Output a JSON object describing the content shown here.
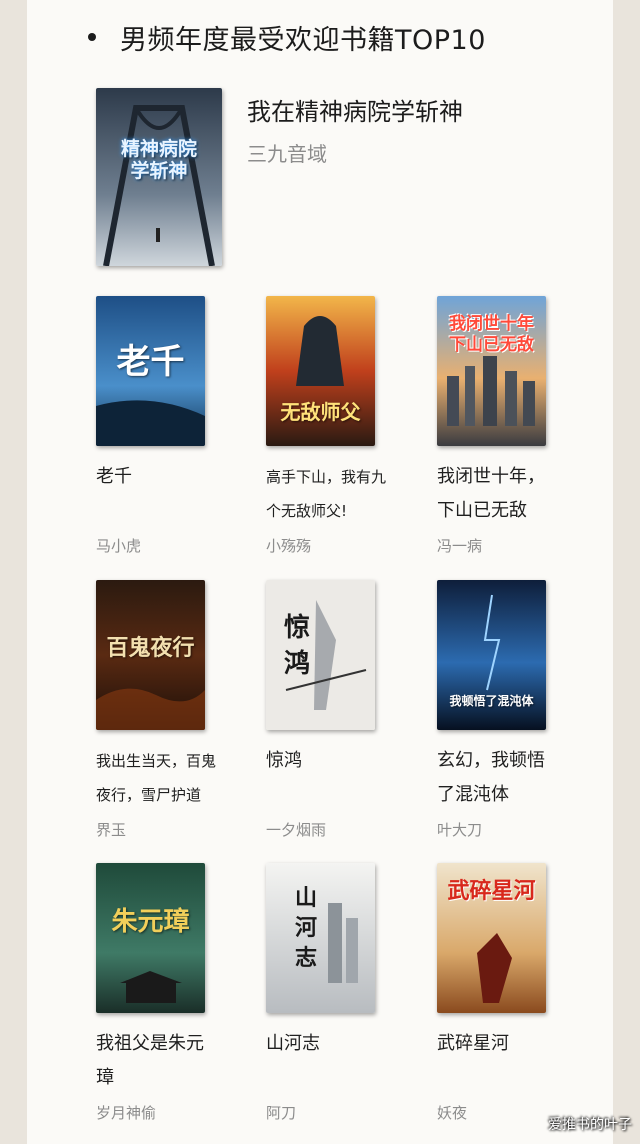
{
  "heading": "男频年度最受欢迎书籍TOP10",
  "featured": {
    "title": "我在精神病院学斩神",
    "author": "三九音域",
    "cover_text": "精神病院\n学斩神",
    "cover_small": "我在"
  },
  "books": [
    {
      "title": "老千",
      "author": "马小虎",
      "cover_text": "老千"
    },
    {
      "title": "高手下山，我有九个无敌师父!",
      "author": "小殇殇",
      "cover_text": "无敌师父"
    },
    {
      "title": "我闭世十年，下山已无敌",
      "author": "冯一病",
      "cover_text": "我闭世十年\n下山已无敌"
    },
    {
      "title": "我出生当天，百鬼夜行，雪尸护道",
      "author": "界玉",
      "cover_text": "百鬼夜行"
    },
    {
      "title": "惊鸿",
      "author": "一夕烟雨",
      "cover_text": "惊鸿"
    },
    {
      "title": "玄幻，我顿悟了混沌体",
      "author": "叶大刀",
      "cover_text": "我顿悟了混沌体"
    },
    {
      "title": "我祖父是朱元璋",
      "author": "岁月神偷",
      "cover_text": "朱元璋"
    },
    {
      "title": "山河志",
      "author": "阿刀",
      "cover_text": "山河志"
    },
    {
      "title": "武碎星河",
      "author": "妖夜",
      "cover_text": "武碎星河"
    }
  ],
  "watermark": "爱推书的叶子",
  "colors": {
    "background": "#e9e4dc",
    "panel": "#fbfaf7",
    "title": "#1f1f1f",
    "author": "#8c8c8c"
  }
}
